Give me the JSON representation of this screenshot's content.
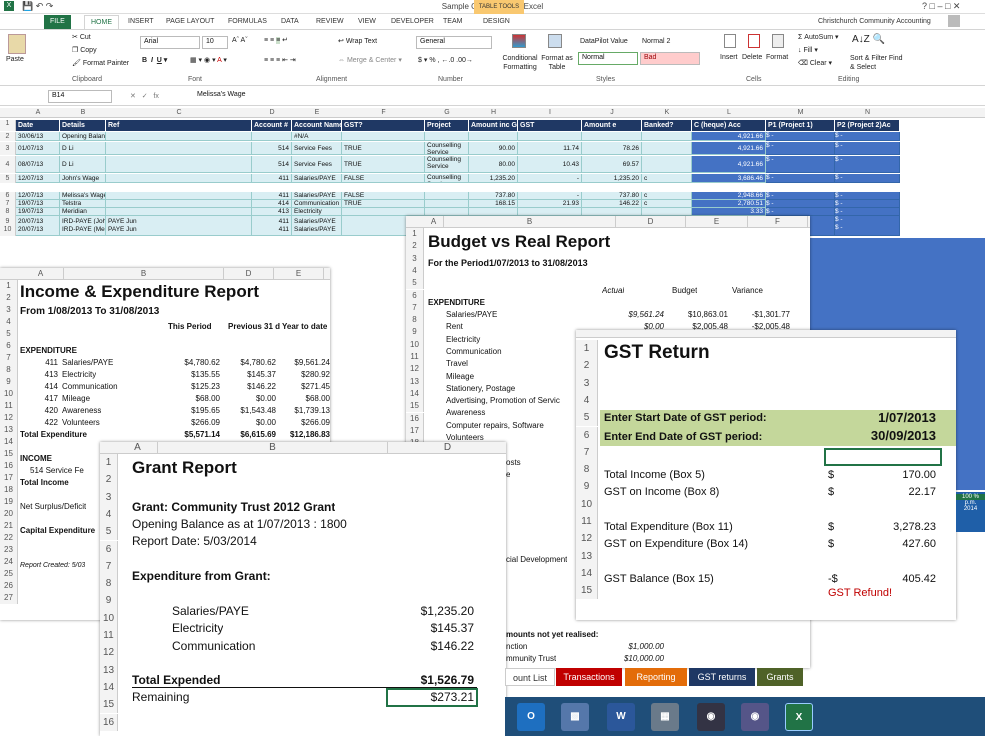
{
  "app": {
    "title": "Sample Organisation - Excel",
    "user": "Christchurch Community Accounting",
    "table_tools": "TABLE TOOLS"
  },
  "tabs": [
    "FILE",
    "HOME",
    "INSERT",
    "PAGE LAYOUT",
    "FORMULAS",
    "DATA",
    "REVIEW",
    "VIEW",
    "DEVELOPER",
    "TEAM",
    "DESIGN"
  ],
  "ribbon": {
    "clipboard": {
      "paste": "Paste",
      "cut": "Cut",
      "copy": "Copy",
      "painter": "Format Painter",
      "label": "Clipboard"
    },
    "font": {
      "name": "Arial",
      "size": "10",
      "label": "Font"
    },
    "alignment": {
      "wrap": "Wrap Text",
      "merge": "Merge & Center",
      "label": "Alignment"
    },
    "number": {
      "format": "General",
      "currency": "$",
      "percent": "%",
      "comma": ",",
      "label": "Number"
    },
    "styles": {
      "conditional": "Conditional Formatting",
      "format_table": "Format as Table",
      "datapilot": "DataPilot Value",
      "normal2": "Normal 2",
      "normal": "Normal",
      "bad": "Bad",
      "label": "Styles"
    },
    "cells": {
      "insert": "Insert",
      "delete": "Delete",
      "format": "Format",
      "label": "Cells"
    },
    "editing": {
      "autosum": "AutoSum",
      "fill": "Fill",
      "clear": "Clear",
      "sort": "Sort & Filter",
      "find": "Find & Select",
      "label": "Editing"
    }
  },
  "formula_bar": {
    "cell_ref": "B14",
    "fx": "fx",
    "value": "Melissa's Wage"
  },
  "ws": {
    "cols": [
      "A",
      "B",
      "C",
      "D",
      "E",
      "F",
      "G",
      "H",
      "I",
      "J",
      "K",
      "L",
      "M",
      "N"
    ],
    "headers": [
      "Date",
      "Details",
      "Ref",
      "Account #",
      "Account Name",
      "GST?",
      "Project",
      "Amount inc G",
      "GST",
      "Amount e",
      "Banked?",
      "C (heque) Acc",
      "P1 (Project 1)",
      "P2 (Project 2)Ac"
    ],
    "rows": [
      [
        "30/06/13",
        "Opening Balances",
        "",
        "",
        "#N/A",
        "",
        "",
        "",
        "",
        "",
        "",
        "4,921.66"
      ],
      [
        "01/07/13",
        "D Li",
        "",
        "514",
        "Service Fees",
        "TRUE",
        "Counselling Service",
        "90.00",
        "11.74",
        "78.26",
        "",
        "4,921.66"
      ],
      [
        "08/07/13",
        "D Li",
        "",
        "514",
        "Service Fees",
        "TRUE",
        "Counselling Service",
        "80.00",
        "10.43",
        "69.57",
        "",
        "4,921.66"
      ],
      [
        "12/07/13",
        "John's Wage",
        "",
        "411",
        "Salaries/PAYE",
        "FALSE",
        "Counselling Service",
        "1,235.20",
        "-",
        "1,235.20",
        "c",
        "3,686.46"
      ],
      [
        "12/07/13",
        "Melissa's Wage",
        "",
        "411",
        "Salaries/PAYE",
        "FALSE",
        "",
        "737.80",
        "-",
        "737.80",
        "c",
        "2,948.66"
      ],
      [
        "19/07/13",
        "Telstra",
        "",
        "414",
        "Communication",
        "TRUE",
        "",
        "168.15",
        "21.93",
        "146.22",
        "c",
        "2,780.51"
      ],
      [
        "19/07/13",
        "Meridian",
        "",
        "413",
        "Electricity",
        "",
        "",
        "",
        "",
        "",
        "",
        "3.33"
      ],
      [
        "20/07/13",
        "IRD-PAYE (John)",
        "PAYE Jun",
        "411",
        "Salaries/PAYE",
        "",
        "",
        "",
        "",
        "",
        "",
        "2.75"
      ],
      [
        "20/07/13",
        "IRD-PAYE (Melissa)",
        "PAYE Jun",
        "411",
        "Salaries/PAYE",
        "",
        "",
        "",
        "",
        "",
        "",
        "8.71"
      ]
    ],
    "extra_L": [
      "8.71",
      "3.71"
    ],
    "zoom": "100 %",
    "time": "p.m.",
    "year": "2014"
  },
  "income": {
    "title": "Income & Expenditure Report",
    "period": "From 1/08/2013 To 31/08/2013",
    "cols": [
      "This Period",
      "Previous 31 d",
      "Year to date"
    ],
    "expend_label": "EXPENDITURE",
    "rows": [
      [
        "411",
        "Salaries/PAYE",
        "$4,780.62",
        "$4,780.62",
        "$9,561.24"
      ],
      [
        "413",
        "Electricity",
        "$135.55",
        "$145.37",
        "$280.92"
      ],
      [
        "414",
        "Communication",
        "$125.23",
        "$146.22",
        "$271.45"
      ],
      [
        "417",
        "Mileage",
        "$68.00",
        "$0.00",
        "$68.00"
      ],
      [
        "420",
        "Awareness",
        "$195.65",
        "$1,543.48",
        "$1,739.13"
      ],
      [
        "422",
        "Volunteers",
        "$266.09",
        "$0.00",
        "$266.09"
      ]
    ],
    "total_exp": [
      "Total Expenditure",
      "$5,571.14",
      "$6,615.69",
      "$12,186.83"
    ],
    "income_label": "INCOME",
    "service": "514  Service Fe",
    "total_income": "Total Income",
    "net": "Net Surplus/Deficit",
    "capex": "Capital Expenditure",
    "created": "Report Created: 5/03"
  },
  "budget": {
    "title": "Budget vs Real Report",
    "period": "For the Period1/07/2013 to 31/08/2013",
    "cols": [
      "Actual",
      "Budget",
      "Variance"
    ],
    "expend_label": "EXPENDITURE",
    "rows": [
      [
        "Salaries/PAYE",
        "$9,561.24",
        "$10,863.01",
        "-$1,301.77"
      ],
      [
        "Rent",
        "$0.00",
        "$2,005.48",
        "-$2,005.48"
      ],
      [
        "Electricity",
        "",
        "",
        ""
      ],
      [
        "Communication",
        "",
        "",
        ""
      ],
      [
        "Travel",
        "",
        "",
        ""
      ],
      [
        "Mileage",
        "",
        "",
        ""
      ],
      [
        "Stationery, Postage",
        "",
        "",
        ""
      ],
      [
        "Advertising, Promotion of Servic",
        "",
        "",
        ""
      ],
      [
        "Awareness",
        "",
        "",
        ""
      ],
      [
        "Computer repairs, Software",
        "",
        "",
        ""
      ],
      [
        "Volunteers",
        "",
        "",
        ""
      ]
    ],
    "costs": "osts",
    "e": "e",
    "social": "cial Development",
    "not_real": "mounts not yet realised:",
    "function": "nction",
    "fval": "$1,000.00",
    "cmt": "mmunity Trust",
    "cval": "$10,000.00"
  },
  "gst": {
    "title": "GST Return",
    "start_label": "Enter Start Date of GST period:",
    "start": "1/07/2013",
    "end_label": "Enter End Date of GST period:",
    "end": "30/09/2013",
    "rows": [
      [
        "Total Income (Box 5)",
        "$",
        "170.00"
      ],
      [
        "GST on Income (Box 8)",
        "$",
        "22.17"
      ],
      [
        "",
        "",
        " "
      ],
      [
        "Total Expenditure (Box 11)",
        "$",
        "3,278.23"
      ],
      [
        "GST on Expenditure (Box 14)",
        "$",
        "427.60"
      ],
      [
        "",
        "",
        " "
      ],
      [
        "GST Balance (Box 15)",
        "-$",
        "405.42"
      ]
    ],
    "refund": "GST Refund!"
  },
  "grant": {
    "title": "Grant Report",
    "grant": "Grant: Community Trust 2012 Grant",
    "opening": "Opening Balance as at 1/07/2013 : 1800",
    "report_date": "Report Date: 5/03/2014",
    "exp_label": "Expenditure from Grant:",
    "rows": [
      [
        "Salaries/PAYE",
        "$1,235.20"
      ],
      [
        "Electricity",
        "$145.37"
      ],
      [
        "Communication",
        "$146.22"
      ]
    ],
    "total": [
      "Total Expended",
      "$1,526.79"
    ],
    "remaining": [
      "Remaining",
      "$273.21"
    ]
  },
  "sheet_tabs": [
    "ount List",
    "Transactions",
    "Reporting",
    "GST returns",
    "Grants"
  ]
}
